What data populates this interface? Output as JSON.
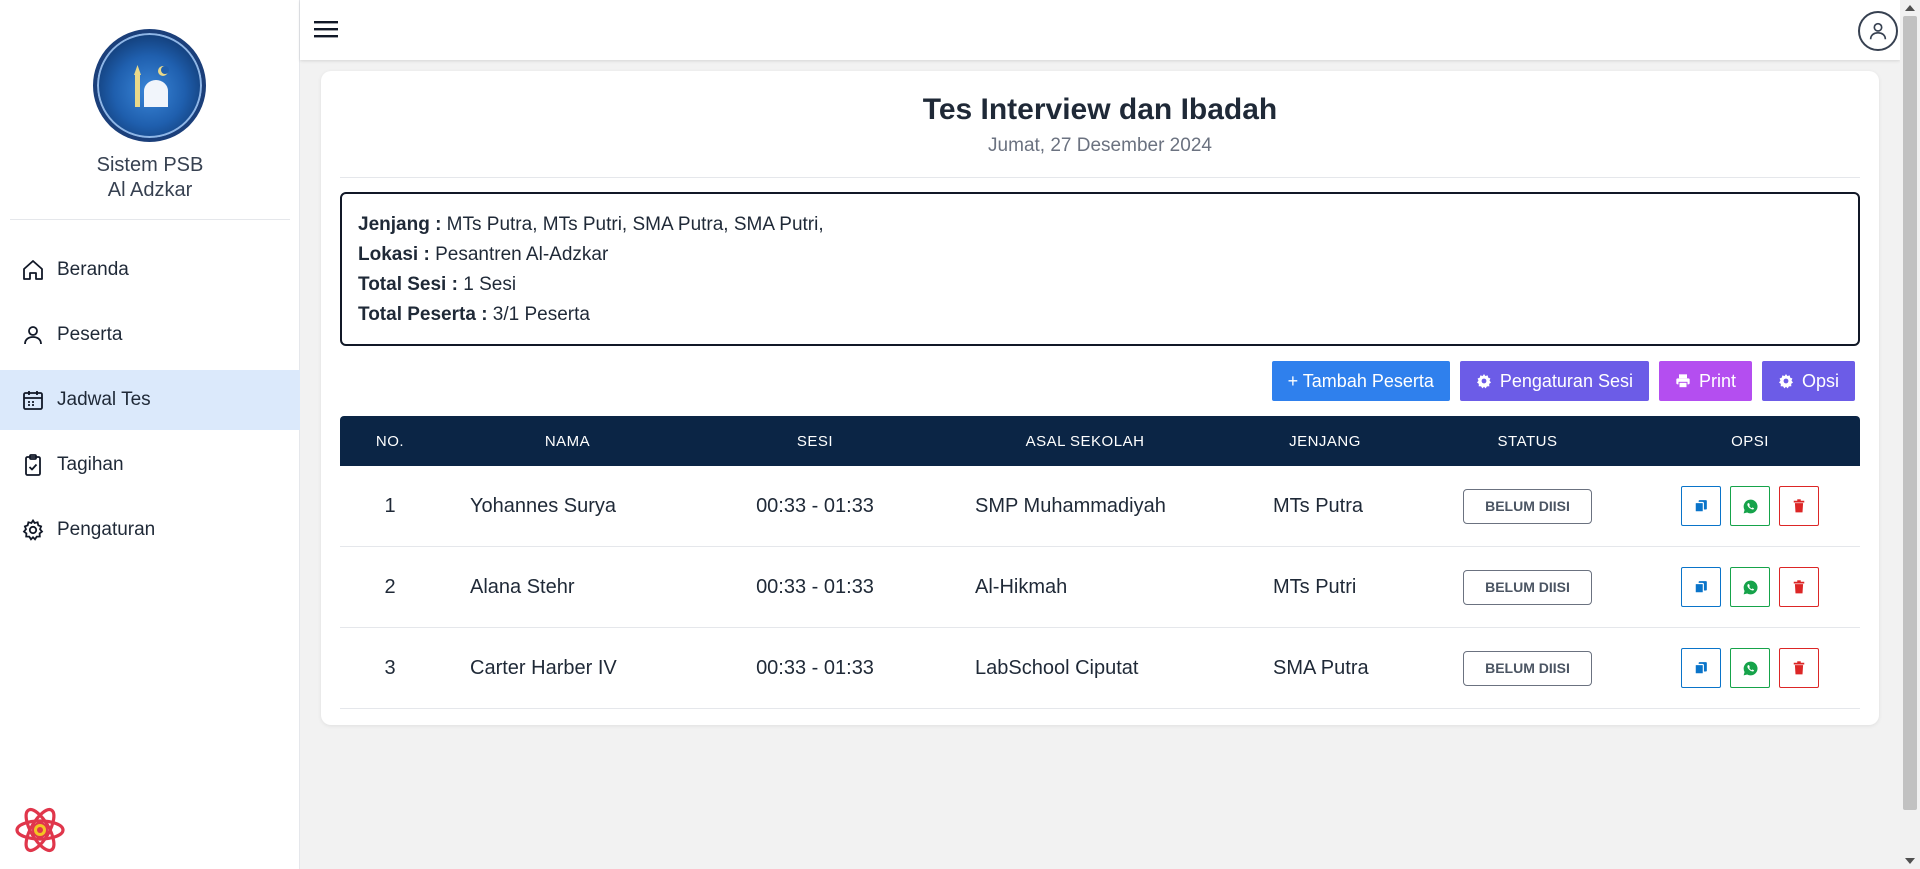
{
  "sidebar": {
    "brand_line1": "Sistem PSB",
    "brand_line2": "Al Adzkar",
    "items": [
      {
        "label": "Beranda",
        "icon": "home-icon"
      },
      {
        "label": "Peserta",
        "icon": "user-icon"
      },
      {
        "label": "Jadwal Tes",
        "icon": "calendar-icon",
        "active": true
      },
      {
        "label": "Tagihan",
        "icon": "clipboard-check-icon"
      },
      {
        "label": "Pengaturan",
        "icon": "gear-icon"
      }
    ]
  },
  "header": {
    "title": "Tes Interview dan Ibadah",
    "date": "Jumat, 27 Desember 2024"
  },
  "info": {
    "jenjang_label": "Jenjang :",
    "jenjang_value": " MTs Putra, MTs Putri, SMA Putra, SMA Putri,",
    "lokasi_label": "Lokasi :",
    "lokasi_value": " Pesantren Al-Adzkar",
    "total_sesi_label": "Total Sesi :",
    "total_sesi_value": " 1 Sesi",
    "total_peserta_label": "Total Peserta :",
    "total_peserta_value": " 3/1 Peserta"
  },
  "actions": {
    "tambah": "+ Tambah Peserta",
    "pengaturan_sesi": "Pengaturan Sesi",
    "print": "Print",
    "opsi": "Opsi"
  },
  "table": {
    "headers": [
      "NO.",
      "NAMA",
      "SESI",
      "ASAL SEKOLAH",
      "JENJANG",
      "STATUS",
      "OPSI"
    ],
    "rows": [
      {
        "no": "1",
        "nama": "Yohannes Surya",
        "sesi": "00:33 - 01:33",
        "asal": "SMP Muhammadiyah",
        "jenjang": "MTs Putra",
        "status": "BELUM DIISI"
      },
      {
        "no": "2",
        "nama": "Alana Stehr",
        "sesi": "00:33 - 01:33",
        "asal": "Al-Hikmah",
        "jenjang": "MTs Putri",
        "status": "BELUM DIISI"
      },
      {
        "no": "3",
        "nama": "Carter Harber IV",
        "sesi": "00:33 - 01:33",
        "asal": "LabSchool Ciputat",
        "jenjang": "SMA Putra",
        "status": "BELUM DIISI"
      }
    ]
  },
  "colors": {
    "accent": "#2f80ed",
    "table_header": "#0b2545",
    "active_nav": "#dbe9fb"
  }
}
